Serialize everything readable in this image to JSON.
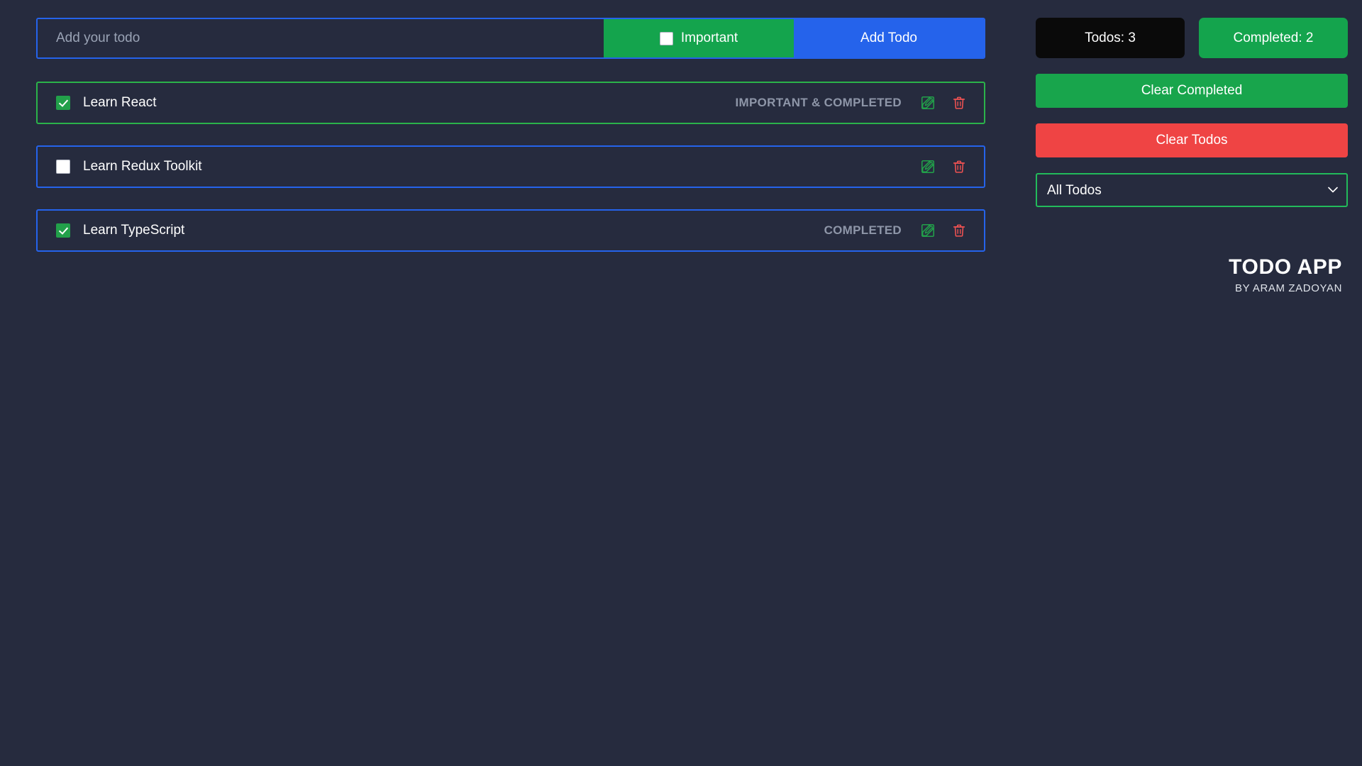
{
  "theme": {
    "background": "#262b3e",
    "accent_blue": "#2563eb",
    "accent_green": "#14a44d",
    "accent_red": "#ef4444",
    "muted_text": "#8e96a8"
  },
  "form": {
    "input_value": "",
    "input_placeholder": "Add your todo",
    "important_label": "Important",
    "important_checked": false,
    "add_label": "Add Todo"
  },
  "todos": [
    {
      "text": "Learn React",
      "completed": true,
      "important": true,
      "status": "IMPORTANT & COMPLETED",
      "edit_label": "Edit",
      "delete_label": "Delete"
    },
    {
      "text": "Learn Redux Toolkit",
      "completed": false,
      "important": false,
      "status": "",
      "edit_label": "Edit",
      "delete_label": "Delete"
    },
    {
      "text": "Learn TypeScript",
      "completed": true,
      "important": false,
      "status": "COMPLETED",
      "edit_label": "Edit",
      "delete_label": "Delete"
    }
  ],
  "sidebar": {
    "todos_count_label": "Todos: 3",
    "completed_count_label": "Completed: 2",
    "clear_completed_label": "Clear Completed",
    "clear_todos_label": "Clear Todos",
    "filter": {
      "selected": "All Todos",
      "options": [
        "All Todos"
      ]
    }
  },
  "branding": {
    "title": "TODO APP",
    "subtitle": "BY ARAM ZADOYAN"
  }
}
